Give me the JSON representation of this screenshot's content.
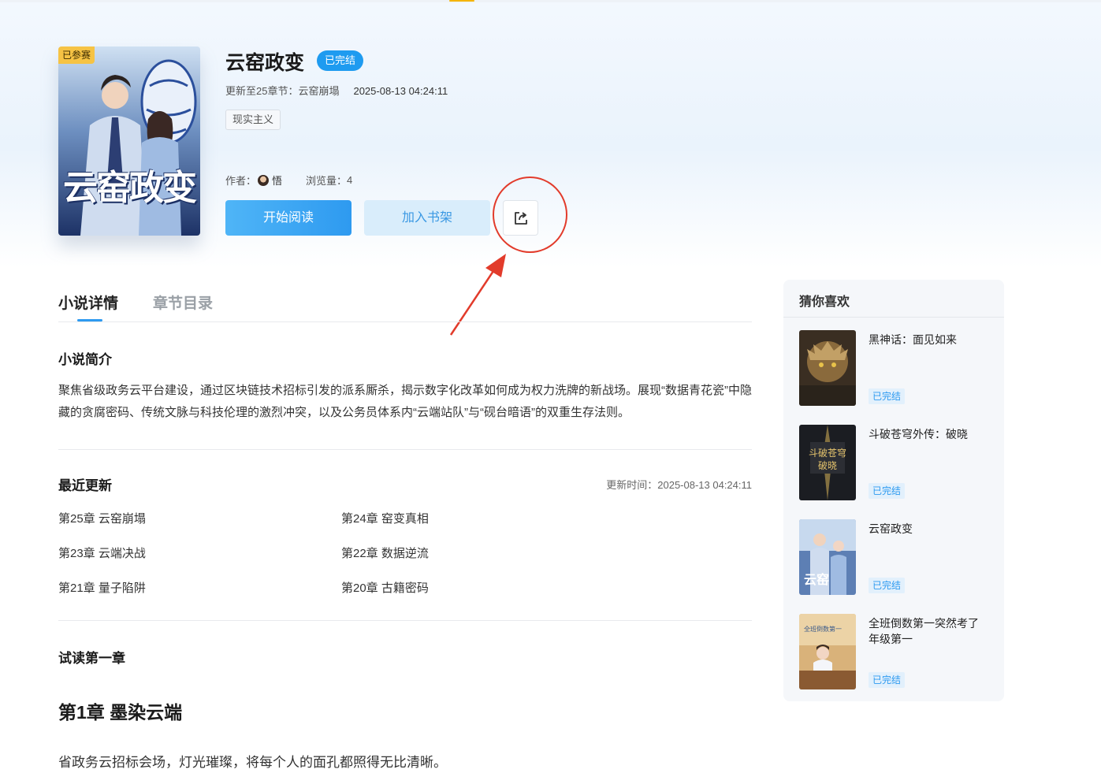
{
  "book": {
    "cover_badge": "已参赛",
    "cover_art_title": "云窑政变",
    "title": "云窑政变",
    "status": "已完结",
    "update_label": "更新至25章节：云窑崩塌",
    "update_time": "2025-08-13 04:24:11",
    "genre": "现实主义",
    "author_label": "作者：",
    "author_name": "悟",
    "views_label": "浏览量：",
    "views": "4"
  },
  "actions": {
    "read_label": "开始阅读",
    "shelf_label": "加入书架",
    "share_icon": "share-icon"
  },
  "tabs": [
    "小说详情",
    "章节目录"
  ],
  "synopsis": {
    "heading": "小说简介",
    "text": "聚焦省级政务云平台建设，通过区块链技术招标引发的派系厮杀，揭示数字化改革如何成为权力洗牌的新战场。展现“数据青花瓷”中隐藏的贪腐密码、传统文脉与科技伦理的激烈冲突，以及公务员体系内“云端站队”与“砚台暗语”的双重生存法则。"
  },
  "latest": {
    "heading": "最近更新",
    "time_label": "更新时间：2025-08-13 04:24:11",
    "chapters": [
      "第25章 云窑崩塌",
      "第24章 窑变真相",
      "第23章 云端决战",
      "第22章 数据逆流",
      "第21章 量子陷阱",
      "第20章 古籍密码"
    ]
  },
  "preview": {
    "heading": "试读第一章",
    "chapter_title": "第1章 墨染云端",
    "first_paragraph": "省政务云招标会场，灯光璀璨，将每个人的面孔都照得无比清晰。"
  },
  "sidebar": {
    "title": "猜你喜欢",
    "items": [
      {
        "title": "黑神话：面见如来",
        "status": "已完结"
      },
      {
        "title": "斗破苍穹外传：破晓",
        "status": "已完结"
      },
      {
        "title": "云窑政变",
        "status": "已完结"
      },
      {
        "title": "全班倒数第一突然考了年级第一",
        "status": "已完结"
      }
    ]
  },
  "colors": {
    "accent": "#2e9af0",
    "annotation": "#e23b2b",
    "badge": "#f6c344"
  }
}
